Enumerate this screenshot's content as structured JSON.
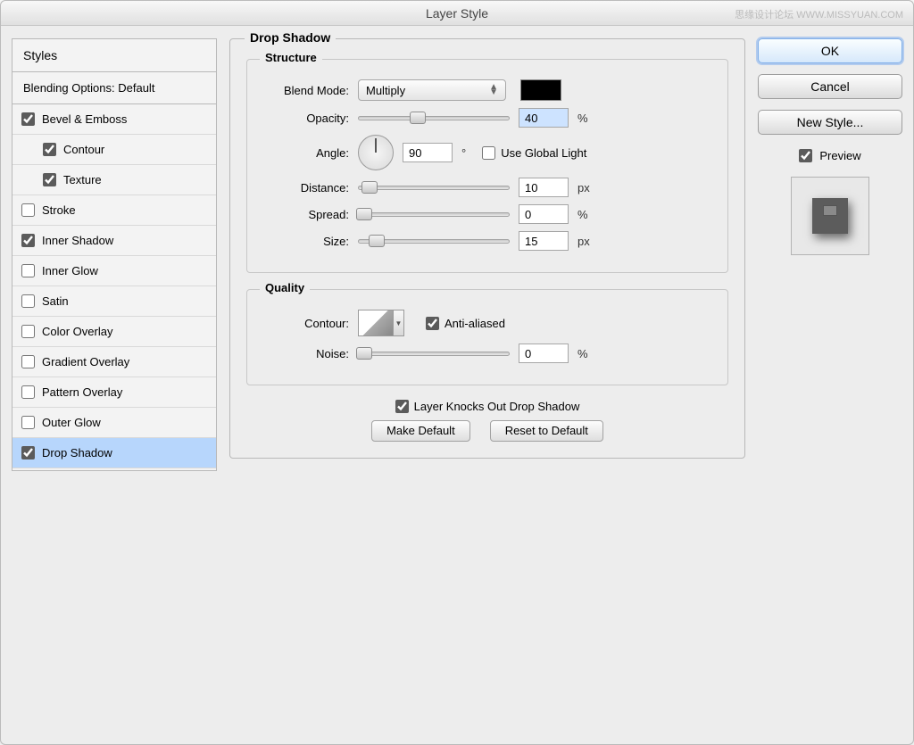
{
  "window": {
    "title": "Layer Style",
    "watermark": "思缘设计论坛 WWW.MISSYUAN.COM"
  },
  "sidebar": {
    "header": "Styles",
    "subheader": "Blending Options: Default",
    "items": [
      {
        "label": "Bevel & Emboss",
        "checked": true,
        "indent": false
      },
      {
        "label": "Contour",
        "checked": true,
        "indent": true
      },
      {
        "label": "Texture",
        "checked": true,
        "indent": true
      },
      {
        "label": "Stroke",
        "checked": false,
        "indent": false
      },
      {
        "label": "Inner Shadow",
        "checked": true,
        "indent": false
      },
      {
        "label": "Inner Glow",
        "checked": false,
        "indent": false
      },
      {
        "label": "Satin",
        "checked": false,
        "indent": false
      },
      {
        "label": "Color Overlay",
        "checked": false,
        "indent": false
      },
      {
        "label": "Gradient Overlay",
        "checked": false,
        "indent": false
      },
      {
        "label": "Pattern Overlay",
        "checked": false,
        "indent": false
      },
      {
        "label": "Outer Glow",
        "checked": false,
        "indent": false
      },
      {
        "label": "Drop Shadow",
        "checked": true,
        "indent": false,
        "selected": true
      }
    ]
  },
  "main": {
    "title": "Drop Shadow",
    "structure": {
      "title": "Structure",
      "blend_mode_label": "Blend Mode:",
      "blend_mode_value": "Multiply",
      "color": "#000000",
      "opacity_label": "Opacity:",
      "opacity_value": "40",
      "opacity_unit": "%",
      "angle_label": "Angle:",
      "angle_value": "90",
      "angle_unit": "°",
      "use_global_label": "Use Global Light",
      "use_global_checked": false,
      "distance_label": "Distance:",
      "distance_value": "10",
      "distance_unit": "px",
      "spread_label": "Spread:",
      "spread_value": "0",
      "spread_unit": "%",
      "size_label": "Size:",
      "size_value": "15",
      "size_unit": "px"
    },
    "quality": {
      "title": "Quality",
      "contour_label": "Contour:",
      "anti_aliased_label": "Anti-aliased",
      "anti_aliased_checked": true,
      "noise_label": "Noise:",
      "noise_value": "0",
      "noise_unit": "%"
    },
    "knockout_label": "Layer Knocks Out Drop Shadow",
    "knockout_checked": true,
    "make_default": "Make Default",
    "reset_default": "Reset to Default"
  },
  "right": {
    "ok": "OK",
    "cancel": "Cancel",
    "new_style": "New Style...",
    "preview_label": "Preview",
    "preview_checked": true
  }
}
